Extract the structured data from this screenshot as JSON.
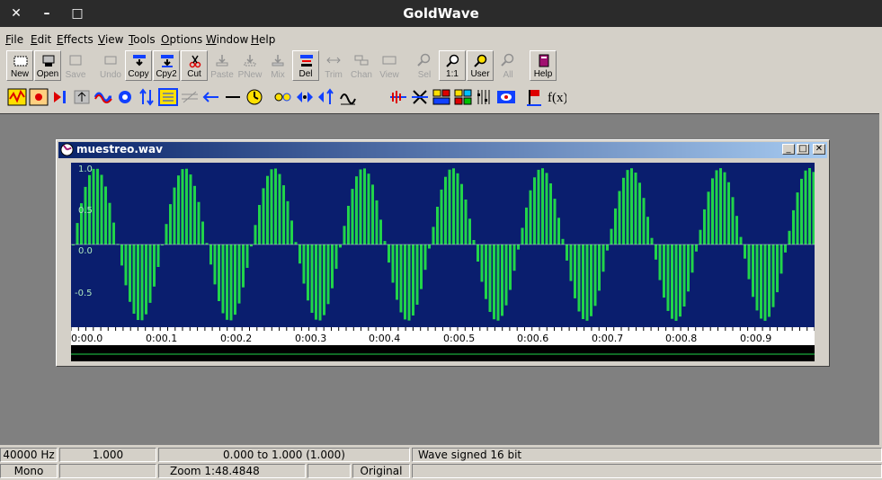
{
  "app": {
    "title": "GoldWave"
  },
  "window_controls": {
    "close": "✕",
    "minimize": "–",
    "maximize": "□"
  },
  "menu": [
    {
      "label": "File",
      "key": "F",
      "rest": "ile"
    },
    {
      "label": "Edit",
      "key": "E",
      "rest": "dit"
    },
    {
      "label": "Effects",
      "key": "E",
      "rest": "ffects"
    },
    {
      "label": "View",
      "key": "V",
      "rest": "iew"
    },
    {
      "label": "Tools",
      "key": "T",
      "rest": "ools"
    },
    {
      "label": "Options",
      "key": "O",
      "rest": "ptions"
    },
    {
      "label": "Window",
      "key": "W",
      "rest": "indow"
    },
    {
      "label": "Help",
      "key": "H",
      "rest": "elp"
    }
  ],
  "toolbar1": [
    {
      "label": "New",
      "enabled": true
    },
    {
      "label": "Open",
      "enabled": true
    },
    {
      "label": "Save",
      "enabled": false
    },
    {
      "label": "Undo",
      "enabled": false
    },
    {
      "label": "Copy",
      "enabled": true
    },
    {
      "label": "Cpy2",
      "enabled": true
    },
    {
      "label": "Cut",
      "enabled": true
    },
    {
      "label": "Paste",
      "enabled": false
    },
    {
      "label": "PNew",
      "enabled": false
    },
    {
      "label": "Mix",
      "enabled": false
    },
    {
      "label": "Del",
      "enabled": true
    },
    {
      "label": "Trim",
      "enabled": false
    },
    {
      "label": "Chan",
      "enabled": false
    },
    {
      "label": "View",
      "enabled": false
    },
    {
      "label": "Sel",
      "enabled": false
    },
    {
      "label": "1:1",
      "enabled": true
    },
    {
      "label": "User",
      "enabled": true
    },
    {
      "label": "All",
      "enabled": false
    },
    {
      "label": "Help",
      "enabled": true
    }
  ],
  "toolbar2": [
    "effect-1-icon",
    "effect-2-icon",
    "reverse-icon",
    "volume-icon",
    "wave-icon",
    "gear-icon",
    "updown-icon",
    "equalizer-icon",
    "filter-icon",
    "left-arrow-icon",
    "line-icon",
    "timer-icon",
    "echo-icon",
    "flange-icon",
    "pitch-icon",
    "resample-icon",
    "doppler-icon",
    "transpose-icon",
    "mixer-icon",
    "spectrum-icon",
    "bars-icon",
    "eye-icon",
    "marker-icon",
    "fx-icon"
  ],
  "document": {
    "title": "muestreo.wav",
    "amplitude_labels": [
      "1.0",
      "0.5",
      "0.0",
      "-0.5"
    ],
    "time_labels": [
      "0:00.0",
      "0:00.1",
      "0:00.2",
      "0:00.3",
      "0:00.4",
      "0:00.5",
      "0:00.6",
      "0:00.7",
      "0:00.8",
      "0:00.9"
    ]
  },
  "colors": {
    "waveform": "#21d44a",
    "wave_bg": "#0a1e6e",
    "caption_start": "#0a246a",
    "caption_end": "#a6caf0"
  },
  "status": {
    "row1": {
      "rate": "40000 Hz",
      "value": "1.000",
      "range": "0.000 to 1.000  (1.000)",
      "format": "Wave signed 16 bit"
    },
    "row2": {
      "channels": "Mono",
      "zoom": "Zoom 1:48.4848",
      "mode": "Original"
    }
  }
}
